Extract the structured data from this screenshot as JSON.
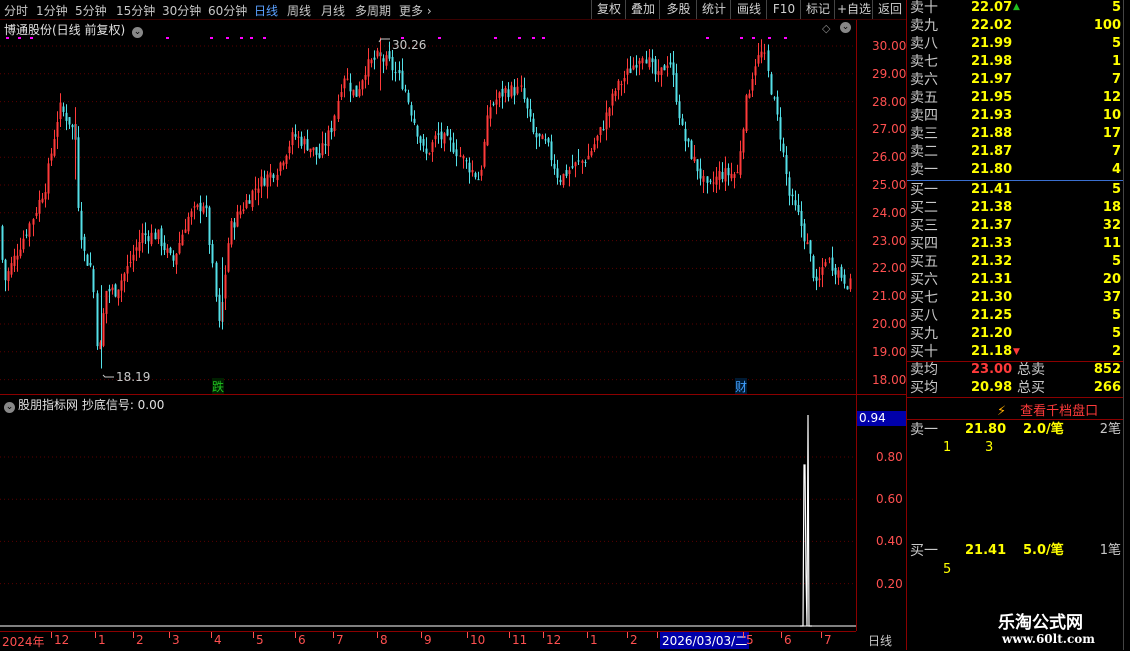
{
  "toolbar": {
    "periods": [
      "分时",
      "1分钟",
      "5分钟",
      "15分钟",
      "30分钟",
      "60分钟",
      "日线",
      "周线",
      "月线",
      "多周期",
      "更多"
    ],
    "active_period": "日线",
    "buttons": [
      "复权",
      "叠加",
      "多股",
      "统计",
      "画线",
      "F10",
      "标记",
      "+自选",
      "返回"
    ]
  },
  "main_chart": {
    "title": "博通股份(日线 前复权)",
    "y_ticks": [
      "30.00",
      "29.00",
      "28.00",
      "27.00",
      "26.00",
      "25.00",
      "24.00",
      "23.00",
      "22.00",
      "21.00",
      "20.00",
      "19.00",
      "18.00"
    ],
    "high_label": "30.26",
    "low_label": "18.19",
    "marker_die": "跌",
    "marker_cai": "财"
  },
  "indicator": {
    "title": "股朋指标网 抄底信号: 0.00",
    "value_box": "0.94",
    "y_ticks": [
      "0.80",
      "0.60",
      "0.40",
      "0.20"
    ]
  },
  "date_axis": {
    "ticks": [
      "2024年",
      "12",
      "1",
      "2",
      "3",
      "4",
      "5",
      "6",
      "7",
      "8",
      "9",
      "10",
      "11",
      "12",
      "1",
      "2",
      "2026/03/03/二",
      "5",
      "6",
      "7"
    ],
    "period_label": "日线"
  },
  "orderbook": {
    "asks": [
      {
        "label": "卖十",
        "price": "22.07",
        "vol": "5"
      },
      {
        "label": "卖九",
        "price": "22.02",
        "vol": "100"
      },
      {
        "label": "卖八",
        "price": "21.99",
        "vol": "5"
      },
      {
        "label": "卖七",
        "price": "21.98",
        "vol": "1"
      },
      {
        "label": "卖六",
        "price": "21.97",
        "vol": "7"
      },
      {
        "label": "卖五",
        "price": "21.95",
        "vol": "12"
      },
      {
        "label": "卖四",
        "price": "21.93",
        "vol": "10"
      },
      {
        "label": "卖三",
        "price": "21.88",
        "vol": "17"
      },
      {
        "label": "卖二",
        "price": "21.87",
        "vol": "7"
      },
      {
        "label": "卖一",
        "price": "21.80",
        "vol": "4"
      }
    ],
    "bids": [
      {
        "label": "买一",
        "price": "21.41",
        "vol": "5"
      },
      {
        "label": "买二",
        "price": "21.38",
        "vol": "18"
      },
      {
        "label": "买三",
        "price": "21.37",
        "vol": "32"
      },
      {
        "label": "买四",
        "price": "21.33",
        "vol": "11"
      },
      {
        "label": "买五",
        "price": "21.32",
        "vol": "5"
      },
      {
        "label": "买六",
        "price": "21.31",
        "vol": "20"
      },
      {
        "label": "买七",
        "price": "21.30",
        "vol": "37"
      },
      {
        "label": "买八",
        "price": "21.25",
        "vol": "5"
      },
      {
        "label": "买九",
        "price": "21.20",
        "vol": "5"
      },
      {
        "label": "买十",
        "price": "21.18",
        "vol": "2"
      }
    ],
    "avg_sell_label": "卖均",
    "avg_sell": "23.00",
    "total_sell_label": "总卖",
    "total_sell": "852",
    "avg_buy_label": "买均",
    "avg_buy": "20.98",
    "total_buy_label": "总买",
    "total_buy": "266",
    "thousand_link": "查看千档盘口",
    "queue_ask_label": "卖一",
    "queue_ask_price": "21.80",
    "queue_ask_per": "2.0/笔",
    "queue_ask_count": "2笔",
    "queue_ask_orders": [
      "1",
      "3"
    ],
    "queue_bid_label": "买一",
    "queue_bid_price": "21.41",
    "queue_bid_per": "5.0/笔",
    "queue_bid_count": "1笔",
    "queue_bid_orders": [
      "5"
    ]
  },
  "watermark": {
    "name": "乐淘公式网",
    "url": "www.60lt.com"
  },
  "colors": {
    "up": "#ff3a3a",
    "down": "#54e0e8",
    "grid": "#8b0000",
    "price": "#ffff00",
    "accent": "#ff00ff"
  }
}
